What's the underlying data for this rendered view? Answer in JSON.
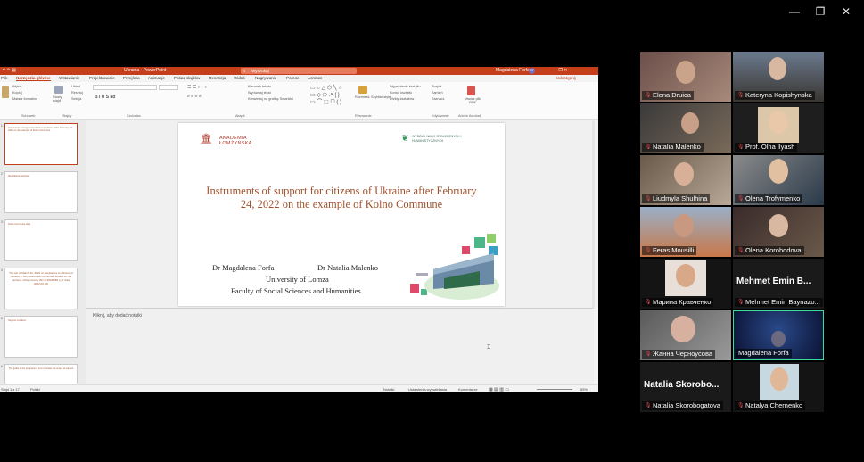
{
  "window_controls": {
    "minimize": "—",
    "restore": "❐",
    "close": "✕"
  },
  "powerpoint": {
    "title": "Ukraina - PowerPoint",
    "search_placeholder": "Wyszukaj",
    "user": "Magdalena Forfa",
    "avatar_initials": "MF",
    "share": "Udostępnij",
    "tabs": [
      "Plik",
      "Narzędzia główne",
      "Wstawianie",
      "Projektowanie",
      "Przejścia",
      "Animacje",
      "Pokaz slajdów",
      "Recenzja",
      "Widok",
      "Nagrywanie",
      "Pomoc",
      "Acrobat"
    ],
    "ribbon": {
      "groups": [
        "Schowek",
        "Slajdy",
        "Czcionka",
        "Akapit",
        "Rysowanie",
        "Edytowanie",
        "Adobe Acrobat"
      ],
      "clipboard": [
        "Wytnij",
        "Kopiuj",
        "Malarz formatów"
      ],
      "slides": [
        "Nowy slajd",
        "Układ",
        "Resetuj",
        "Sekcja"
      ],
      "drawing": [
        "Kształty",
        "Rozmieść",
        "Szybkie style"
      ],
      "shape_options": [
        "Wypełnienie kształtu",
        "Kontur kształtu",
        "Efekty kształtów"
      ],
      "editing": [
        "Znajdź",
        "Zamień",
        "Zaznacz"
      ],
      "acrobat": "Utwórz plik PDF",
      "paragraph_options": [
        "Kierunek tekstu",
        "Wyrównaj tekst",
        "Konwertuj na grafikę SmartArt"
      ]
    },
    "slide": {
      "logo_left": "AKADEMIA ŁOMŻYŃSKA",
      "logo_right": "WYDZIAŁ NAUK SPOŁECZNYCH I HUMANISTYCZNYCH",
      "title": "Instruments of support for citizens of Ukraine after February 24, 2022 on the example of Kolno Commune",
      "author1": "Dr Magdalena Forfa",
      "author2": "Dr Natalia Malenko",
      "university": "University of Lomza",
      "faculty": "Faculty of Social Sciences and Humanities"
    },
    "thumbnails": [
      {
        "n": "1",
        "text": "Instruments of support for citizens of Ukraine after February 24, 2022 on the example of Kolno Commune"
      },
      {
        "n": "2",
        "text": "Regulations and law"
      },
      {
        "n": "3",
        "text": "Kolno Commune data"
      },
      {
        "n": "4",
        "text": "The act of March 12, 2022 on assistance to citizens of Ukraine in connection with the armed conflict on the territory of the country (Dz.U.2022.583 t.j. z dnia 2022.03.18)"
      },
      {
        "n": "5",
        "text": "Support numbers"
      },
      {
        "n": "6",
        "text": "The goals of the programme is to increase the scope of support"
      }
    ],
    "notes_placeholder": "Kliknij, aby dodać notatki",
    "status": {
      "slide": "Slajd 1 z 17",
      "language": "Polski",
      "notes": "Notatki",
      "display": "Ustawienia wyświetlania",
      "comments": "Komentarze",
      "zoom": "55%"
    }
  },
  "participants": [
    {
      "name": "Elena Druica",
      "muted": true
    },
    {
      "name": "Kateryna Kopishynska",
      "muted": true
    },
    {
      "name": "Natalia Malenko",
      "muted": true
    },
    {
      "name": "Prof. Olha Ilyash",
      "muted": true
    },
    {
      "name": "Liudmyla Shulhina",
      "muted": true
    },
    {
      "name": "Olena Trofymenko",
      "muted": true
    },
    {
      "name": "Feras Mousilli",
      "muted": true
    },
    {
      "name": "Olena Korohodova",
      "muted": true
    },
    {
      "name": "Марина Кравченко",
      "muted": true
    },
    {
      "name": "Mehmet Emin Baynazo...",
      "display": "Mehmet Emin B...",
      "muted": true
    },
    {
      "name": "Жанна Черноусова",
      "muted": true
    },
    {
      "name": "Magdalena Forfa",
      "muted": false,
      "speaking": true
    },
    {
      "name": "Natalia Skorobogatova",
      "display": "Natalia Skorobo...",
      "muted": true
    },
    {
      "name": "Natalya Chernenko",
      "muted": true
    }
  ],
  "colors": {
    "ppt_accent": "#c43e1c",
    "speaking_border": "#3ddc97",
    "muted_icon": "#e5484d",
    "slide_title": "#a0522d"
  }
}
